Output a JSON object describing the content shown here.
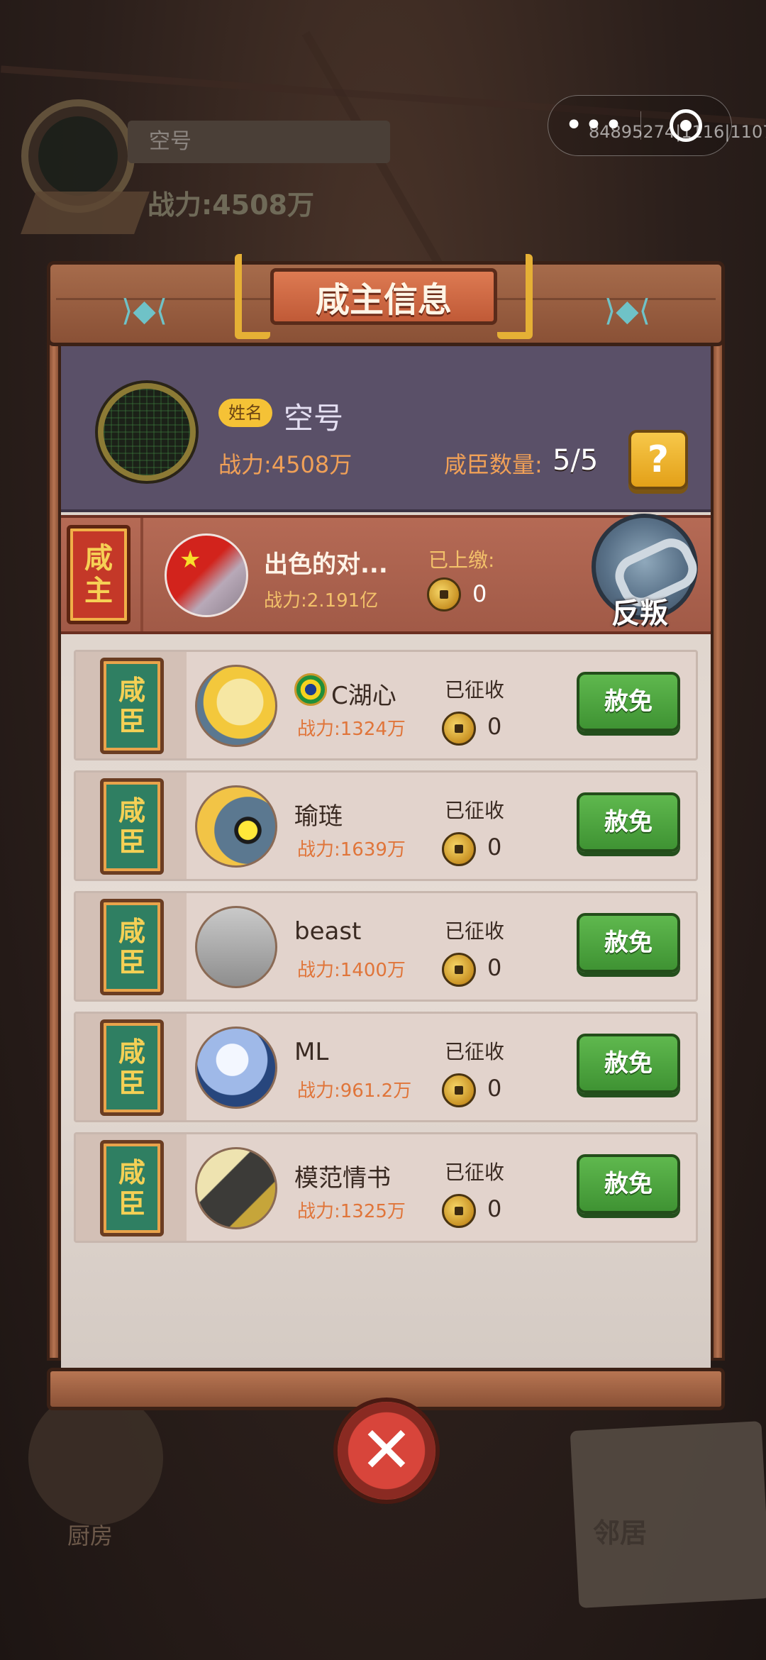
{
  "background": {
    "bg_name": "空号",
    "bg_power": "战力:4508万",
    "kitchen_label": "厨房",
    "neighbor_label": "邻居"
  },
  "capsule": {
    "more_icon": "more-dots-icon",
    "close_icon": "target-close-icon",
    "overlay_id": "84895274|1116|1107"
  },
  "dialog": {
    "title": "咸主信息",
    "fish_icon": "fish-icon",
    "owner": {
      "name_tag": "姓名",
      "name": "空号",
      "power": "战力:4508万",
      "count_label": "咸臣数量:",
      "count": "5/5",
      "help_label": "?"
    },
    "lord": {
      "badge_top": "咸",
      "badge_bottom": "主",
      "name": "出色的对...",
      "power": "战力:2.191亿",
      "paid_label": "已上缴:",
      "paid_value": "0",
      "rebel_label": "反叛"
    },
    "ministers": [
      {
        "badge_top": "咸",
        "badge_bottom": "臣",
        "name": "C湖心",
        "power": "战力:1324万",
        "collected_label": "已征收",
        "collected": "0",
        "action": "赦免"
      },
      {
        "badge_top": "咸",
        "badge_bottom": "臣",
        "name": "瑜琏",
        "power": "战力:1639万",
        "collected_label": "已征收",
        "collected": "0",
        "action": "赦免"
      },
      {
        "badge_top": "咸",
        "badge_bottom": "臣",
        "name": "beast",
        "power": "战力:1400万",
        "collected_label": "已征收",
        "collected": "0",
        "action": "赦免"
      },
      {
        "badge_top": "咸",
        "badge_bottom": "臣",
        "name": "ML",
        "power": "战力:961.2万",
        "collected_label": "已征收",
        "collected": "0",
        "action": "赦免"
      },
      {
        "badge_top": "咸",
        "badge_bottom": "臣",
        "name": "模范情书",
        "power": "战力:1325万",
        "collected_label": "已征收",
        "collected": "0",
        "action": "赦免"
      }
    ],
    "close_label": "✕"
  },
  "colors": {
    "header_bg": "#5a5068",
    "lord_row": "#b56a55",
    "power_text": "#f0a057",
    "pardon_green": "#4fa63f",
    "close_red": "#d8453b"
  }
}
